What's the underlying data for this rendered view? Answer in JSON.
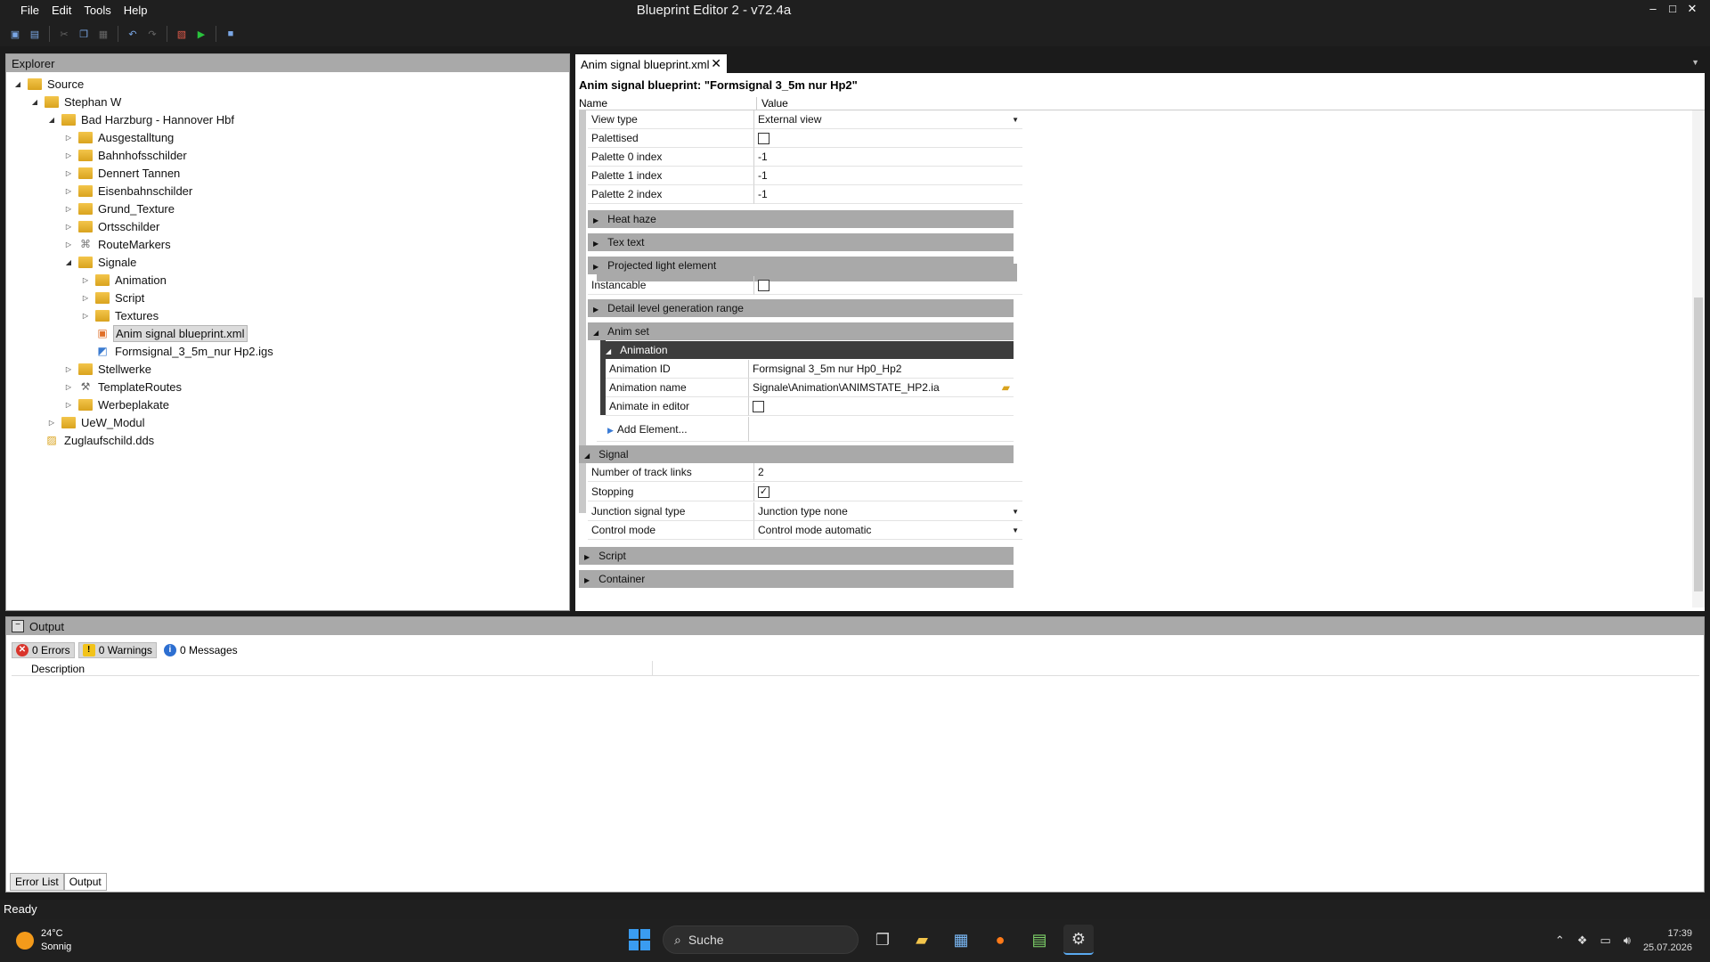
{
  "app": {
    "title": "Blueprint Editor 2 - v72.4a",
    "menu": [
      "File",
      "Edit",
      "Tools",
      "Help"
    ],
    "window_controls": [
      "–",
      "□",
      "✕"
    ]
  },
  "explorer": {
    "title": "Explorer",
    "tree": [
      {
        "label": "Source",
        "depth": 0,
        "arrow": "◢",
        "icon": "folder"
      },
      {
        "label": "Stephan W",
        "depth": 1,
        "arrow": "◢",
        "icon": "folder"
      },
      {
        "label": "Bad Harzburg - Hannover Hbf",
        "depth": 2,
        "arrow": "◢",
        "icon": "folder"
      },
      {
        "label": "Ausgestalltung",
        "depth": 3,
        "arrow": "▷",
        "icon": "folder"
      },
      {
        "label": "Bahnhofsschilder",
        "depth": 3,
        "arrow": "▷",
        "icon": "folder"
      },
      {
        "label": "Dennert Tannen",
        "depth": 3,
        "arrow": "▷",
        "icon": "folder"
      },
      {
        "label": "Eisenbahnschilder",
        "depth": 3,
        "arrow": "▷",
        "icon": "folder"
      },
      {
        "label": "Grund_Texture",
        "depth": 3,
        "arrow": "▷",
        "icon": "folder"
      },
      {
        "label": "Ortsschilder",
        "depth": 3,
        "arrow": "▷",
        "icon": "folder"
      },
      {
        "label": "RouteMarkers",
        "depth": 3,
        "arrow": "▷",
        "icon": "marker"
      },
      {
        "label": "Signale",
        "depth": 3,
        "arrow": "◢",
        "icon": "folder"
      },
      {
        "label": "Animation",
        "depth": 4,
        "arrow": "▷",
        "icon": "folder"
      },
      {
        "label": "Script",
        "depth": 4,
        "arrow": "▷",
        "icon": "folder"
      },
      {
        "label": "Textures",
        "depth": 4,
        "arrow": "▷",
        "icon": "folder"
      },
      {
        "label": "Anim signal blueprint.xml",
        "depth": 4,
        "arrow": "",
        "icon": "blueprint",
        "selected": true
      },
      {
        "label": "Formsignal_3_5m_nur Hp2.igs",
        "depth": 4,
        "arrow": "",
        "icon": "geometry"
      },
      {
        "label": "Stellwerke",
        "depth": 3,
        "arrow": "▷",
        "icon": "folder"
      },
      {
        "label": "TemplateRoutes",
        "depth": 3,
        "arrow": "▷",
        "icon": "template"
      },
      {
        "label": "Werbeplakate",
        "depth": 3,
        "arrow": "▷",
        "icon": "folder"
      },
      {
        "label": "UeW_Modul",
        "depth": 2,
        "arrow": "▷",
        "icon": "folder"
      },
      {
        "label": "Zuglaufschild.dds",
        "depth": 1,
        "arrow": "",
        "icon": "texture"
      }
    ]
  },
  "document": {
    "tab_label": "Anim signal blueprint.xml",
    "heading": "Anim signal blueprint: \"Formsignal 3_5m nur Hp2\"",
    "columns": {
      "name": "Name",
      "value": "Value"
    },
    "rows": {
      "view_type": {
        "name": "View type",
        "value": "External view"
      },
      "palettised": {
        "name": "Palettised"
      },
      "palette0": {
        "name": "Palette 0 index",
        "value": "-1"
      },
      "palette1": {
        "name": "Palette 1 index",
        "value": "-1"
      },
      "palette2": {
        "name": "Palette 2 index",
        "value": "-1"
      },
      "instancable": {
        "name": "Instancable"
      },
      "animation_id": {
        "name": "Animation ID",
        "value": "Formsignal 3_5m nur Hp0_Hp2"
      },
      "animation_name": {
        "name": "Animation name",
        "value": "Signale\\Animation\\ANIMSTATE_HP2.ia"
      },
      "animate_in_editor": {
        "name": "Animate in editor"
      },
      "track_links": {
        "name": "Number of track links",
        "value": "2"
      },
      "stopping": {
        "name": "Stopping",
        "value": "✓"
      },
      "junction_signal_type": {
        "name": "Junction signal type",
        "value": "Junction type none"
      },
      "control_mode": {
        "name": "Control mode",
        "value": "Control mode automatic"
      }
    },
    "sections": {
      "heat_haze": "Heat haze",
      "tex_text": "Tex text",
      "projected_light": "Projected light element",
      "detail_level": "Detail level generation range",
      "anim_set": "Anim set",
      "animation": "Animation",
      "add_element": "Add Element...",
      "signal": "Signal",
      "script": "Script",
      "container": "Container"
    }
  },
  "output": {
    "title": "Output",
    "errors": "0 Errors",
    "warnings": "0 Warnings",
    "messages": "0 Messages",
    "column": "Description",
    "tabs": [
      "Error List",
      "Output"
    ]
  },
  "status": "Ready",
  "taskbar": {
    "temperature": "24°C",
    "condition": "Sonnig",
    "search": "Suche",
    "time": "17:39",
    "date": "25.07.2026"
  }
}
